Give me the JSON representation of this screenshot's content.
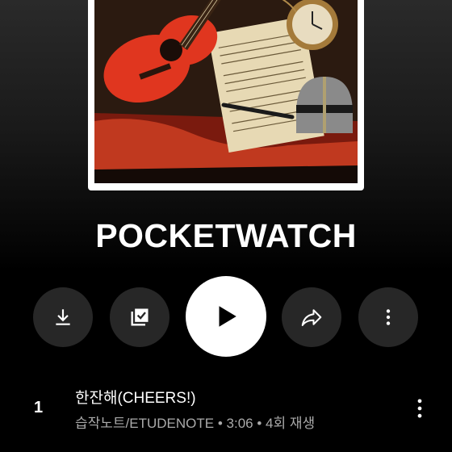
{
  "playlist": {
    "title": "POCKETWATCH"
  },
  "actions": {
    "download": "download-icon",
    "save": "library-add-check-icon",
    "play": "play-icon",
    "share": "share-icon",
    "more": "more-vert-icon"
  },
  "tracks": [
    {
      "index": "1",
      "title": "한잔해(CHEERS!)",
      "meta": "습작노트/ETUDENOTE • 3:06 • 4회 재생"
    }
  ],
  "colors": {
    "background": "#000000",
    "button_bg": "#272727",
    "play_bg": "#ffffff",
    "meta_text": "#aaaaaa"
  }
}
